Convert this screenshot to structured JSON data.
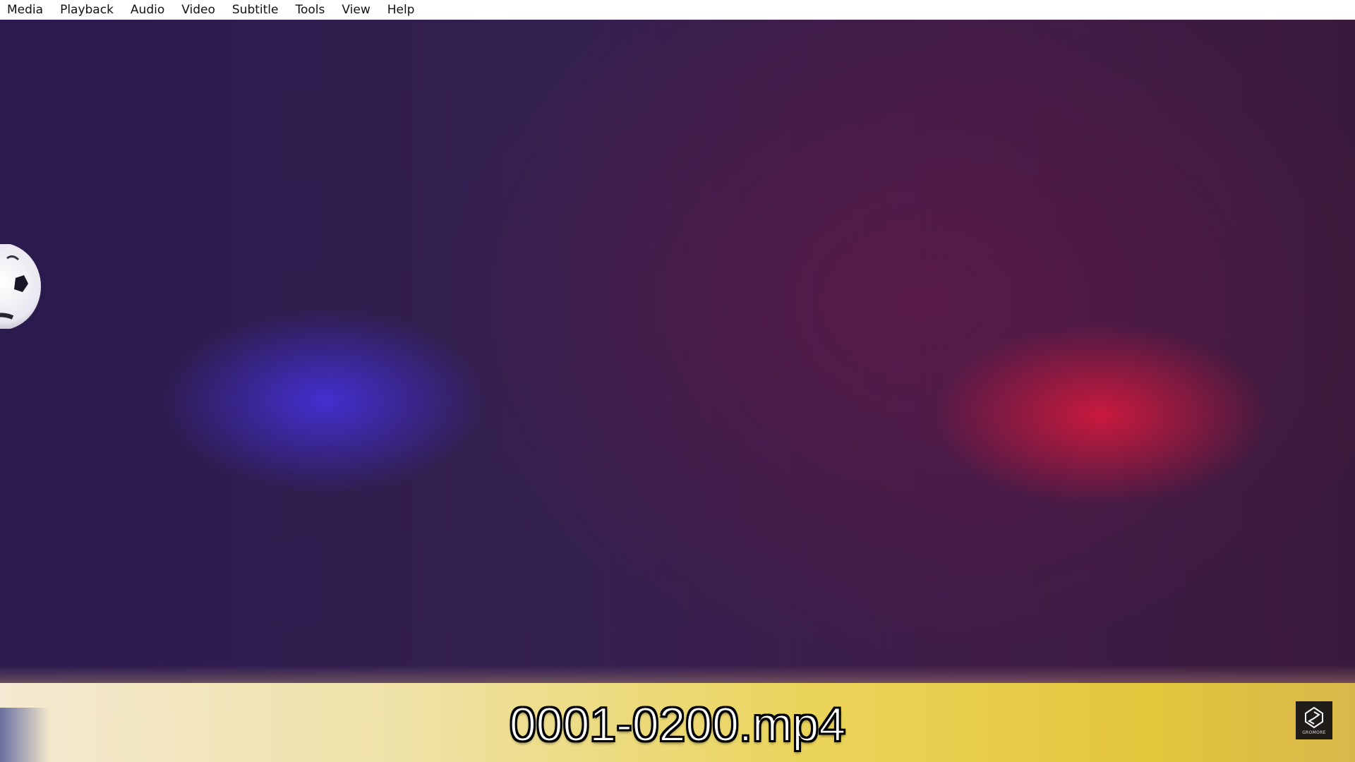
{
  "menubar": {
    "items": [
      "Media",
      "Playback",
      "Audio",
      "Video",
      "Subtitle",
      "Tools",
      "View",
      "Help"
    ]
  },
  "video": {
    "subtitle": "0001-0200.mp4",
    "logo_text": "GROMORE"
  },
  "colors": {
    "menubar_bg": "#ffffff",
    "subtitle_fill": "#ffffff",
    "subtitle_outline": "#000000",
    "blue_light": "#4632e6",
    "red_light": "#d7193c",
    "floor_yellow": "#ead45a"
  },
  "icons": [
    "soccer-ball",
    "gromore-logo-icon"
  ]
}
